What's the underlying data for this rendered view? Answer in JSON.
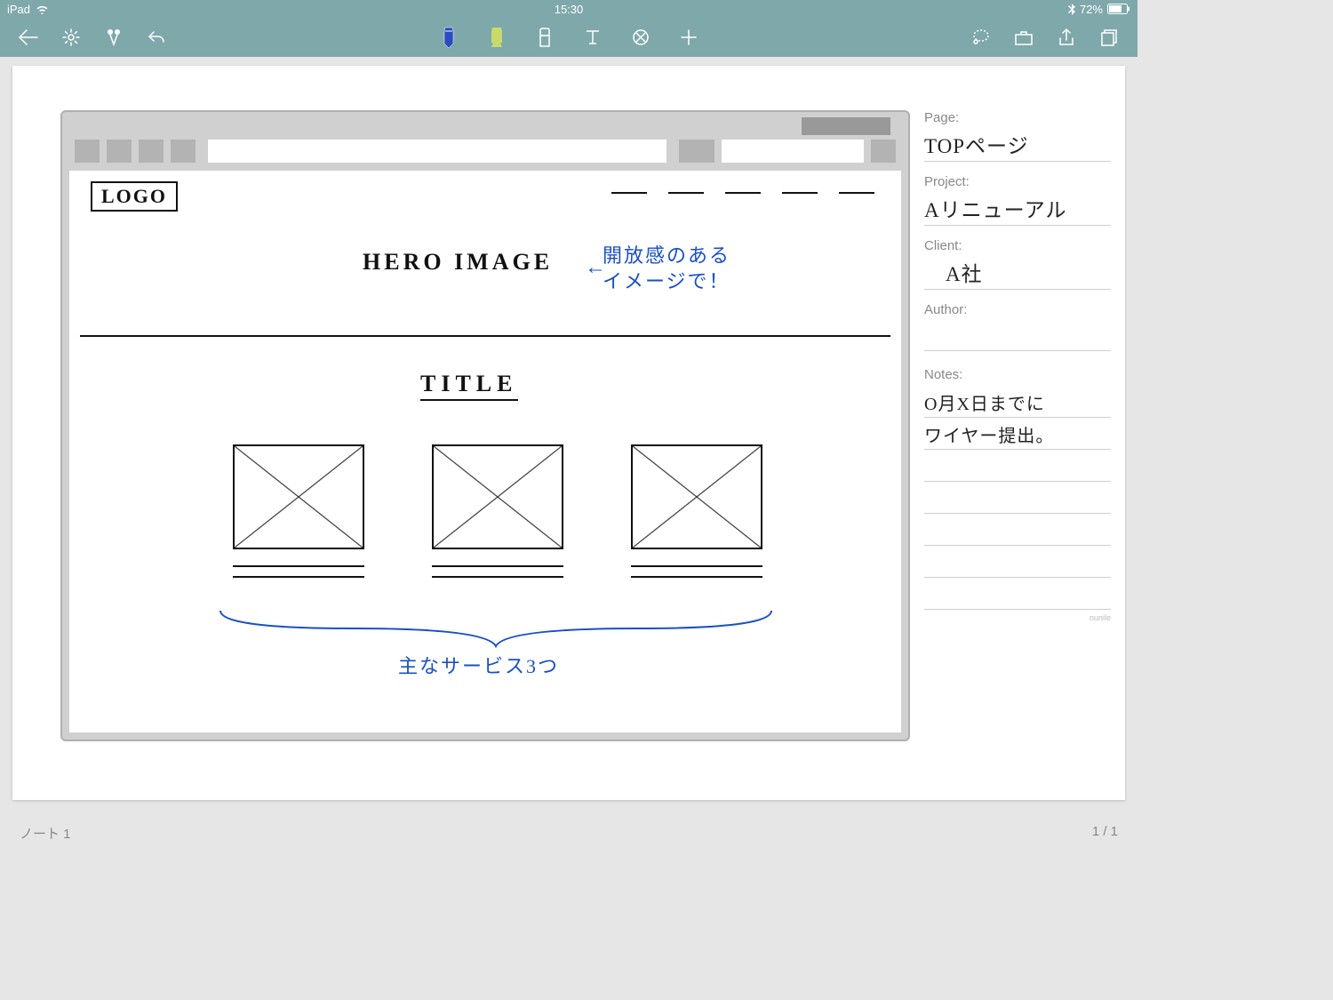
{
  "status": {
    "device": "iPad",
    "time": "15:30",
    "battery": "72%"
  },
  "footer": {
    "note_name": "ノート 1",
    "page_counter": "1 / 1"
  },
  "side": {
    "page_label": "Page:",
    "page_value": "TOPページ",
    "project_label": "Project:",
    "project_value": "Aリニューアル",
    "client_label": "Client:",
    "client_value": "A社",
    "author_label": "Author:",
    "author_value": "",
    "notes_label": "Notes:",
    "notes_line1": "O月X日までに",
    "notes_line2": "ワイヤー提出。",
    "credit": "nunile"
  },
  "wireframe": {
    "logo": "LOGO",
    "hero_label": "HERO IMAGE",
    "hero_annotation": "開放感のある\nイメージで！",
    "title_label": "TITLE",
    "services_annotation": "主なサービス3つ"
  }
}
